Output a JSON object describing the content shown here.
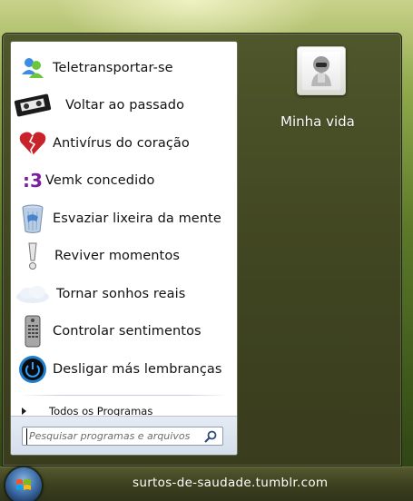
{
  "start_menu": {
    "programs": [
      {
        "label": "Teletransportar-se",
        "icon": "people-messenger-icon"
      },
      {
        "label": "Voltar ao passado",
        "icon": "vhs-tape-icon"
      },
      {
        "label": "Antivírus do coração",
        "icon": "broken-heart-icon"
      },
      {
        "label": "Vemk concedido",
        "icon": "emoticon-icon",
        "icon_text": ":3"
      },
      {
        "label": "Esvaziar lixeira da mente",
        "icon": "recycle-bin-icon"
      },
      {
        "label": "Reviver momentos",
        "icon": "exclamation-icon"
      },
      {
        "label": "Tornar sonhos reais",
        "icon": "cloud-icon"
      },
      {
        "label": "Controlar sentimentos",
        "icon": "remote-control-icon"
      },
      {
        "label": "Desligar más lembranças",
        "icon": "power-button-icon"
      }
    ],
    "all_programs_label": "Todos os Programas",
    "search": {
      "placeholder": "Pesquisar programas e arquivos",
      "value": ""
    },
    "right_pane": {
      "user_link": "Minha vida"
    }
  },
  "taskbar": {
    "caption": "surtos-de-saudade.tumblr.com"
  },
  "colors": {
    "frame": "#3e4220",
    "pane_bg": "#ffffff",
    "accent_blue": "#1f7fcf",
    "heart_red": "#c8222a",
    "emoticon_purple": "#7a1fa0"
  }
}
